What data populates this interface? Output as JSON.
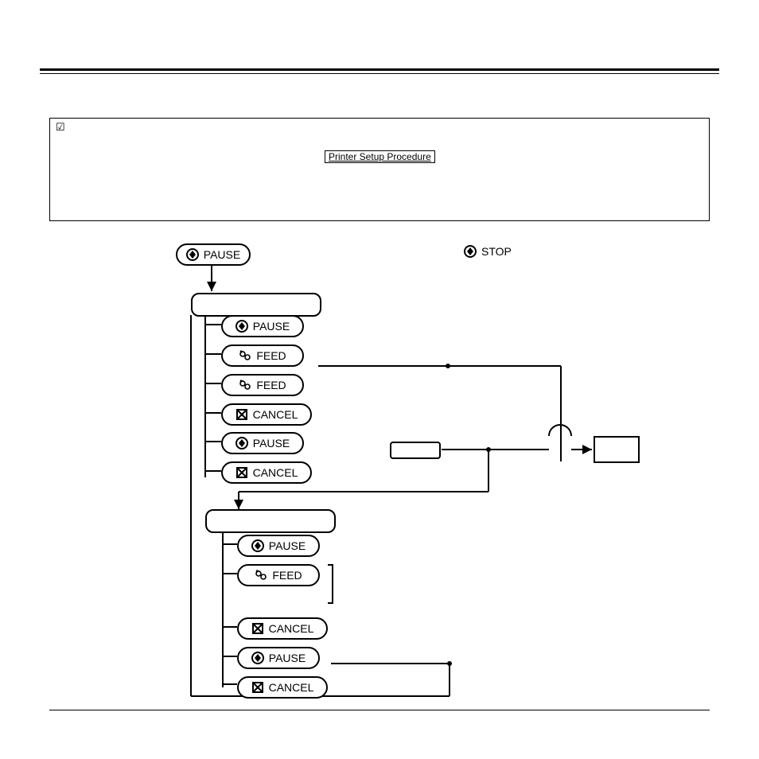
{
  "header": {
    "checkbox": "☑",
    "setup_label": "Printer Setup Procedure"
  },
  "top": {
    "pause": "PAUSE",
    "stop": "STOP"
  },
  "group1": {
    "buttons": [
      "PAUSE",
      "FEED",
      "FEED",
      "CANCEL",
      "PAUSE",
      "CANCEL"
    ]
  },
  "group2": {
    "buttons": [
      "PAUSE",
      "FEED",
      "CANCEL",
      "PAUSE",
      "CANCEL"
    ]
  }
}
